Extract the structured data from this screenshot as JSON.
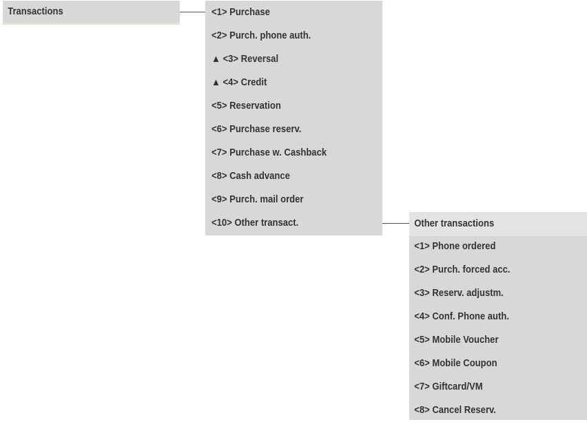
{
  "root_menu": {
    "label": "Transactions"
  },
  "transactions_menu": {
    "items": [
      {
        "label": "<1> Purchase",
        "marker": ""
      },
      {
        "label": "<2> Purch. phone auth.",
        "marker": ""
      },
      {
        "label": "<3> Reversal",
        "marker": "▲"
      },
      {
        "label": "<4> Credit",
        "marker": "▲"
      },
      {
        "label": "<5> Reservation",
        "marker": ""
      },
      {
        "label": "<6> Purchase reserv.",
        "marker": ""
      },
      {
        "label": "<7> Purchase w. Cashback",
        "marker": ""
      },
      {
        "label": "<8> Cash advance",
        "marker": ""
      },
      {
        "label": "<9> Purch. mail order",
        "marker": ""
      },
      {
        "label": "<10> Other transact.",
        "marker": ""
      }
    ]
  },
  "other_menu": {
    "title": "Other transactions",
    "items": [
      {
        "label": "<1> Phone ordered"
      },
      {
        "label": "<2> Purch. forced acc."
      },
      {
        "label": "<3> Reserv. adjustm."
      },
      {
        "label": "<4> Conf. Phone auth."
      },
      {
        "label": "<5> Mobile Voucher"
      },
      {
        "label": "<6> Mobile Coupon"
      },
      {
        "label": "<7> Giftcard/VM"
      },
      {
        "label": "<8> Cancel Reserv."
      }
    ]
  },
  "colors": {
    "menu_background": "#d8d8d8",
    "header_background": "#e4e4e4",
    "text": "#333333",
    "connector": "#555555"
  }
}
